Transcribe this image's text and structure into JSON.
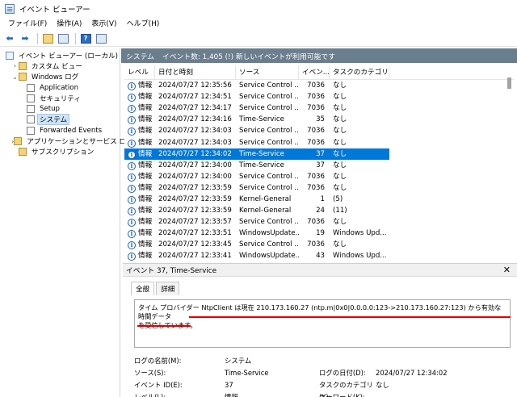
{
  "window": {
    "title": "イベント ビューアー"
  },
  "menu": [
    "ファイル(F)",
    "操作(A)",
    "表示(V)",
    "ヘルプ(H)"
  ],
  "toolbar": {
    "back": "⬅",
    "forward": "➡"
  },
  "tree": {
    "items": [
      {
        "label": "イベント ビューアー (ローカル)",
        "indent": 0,
        "exp": "",
        "icon": "app"
      },
      {
        "label": "カスタム ビュー",
        "indent": 1,
        "exp": "›",
        "icon": "folder"
      },
      {
        "label": "Windows ログ",
        "indent": 1,
        "exp": "⌄",
        "icon": "folder"
      },
      {
        "label": "Application",
        "indent": 2,
        "exp": "",
        "icon": "log"
      },
      {
        "label": "セキュリティ",
        "indent": 2,
        "exp": "",
        "icon": "log"
      },
      {
        "label": "Setup",
        "indent": 2,
        "exp": "",
        "icon": "log"
      },
      {
        "label": "システム",
        "indent": 2,
        "exp": "",
        "icon": "log",
        "selected": true
      },
      {
        "label": "Forwarded Events",
        "indent": 2,
        "exp": "",
        "icon": "log"
      },
      {
        "label": "アプリケーションとサービス ログ",
        "indent": 1,
        "exp": "›",
        "icon": "folder"
      },
      {
        "label": "サブスクリプション",
        "indent": 1,
        "exp": "",
        "icon": "folder"
      }
    ]
  },
  "events_header": {
    "name": "システム",
    "info": "イベント数: 1,405 (!) 新しいイベントが利用可能です"
  },
  "grid": {
    "columns": [
      "レベル",
      "日付と時刻",
      "ソース",
      "イベン...",
      "タスクのカテゴリ"
    ],
    "rows": [
      [
        "情報",
        "2024/07/27 12:35:56",
        "Service Control ...",
        "7036",
        "なし"
      ],
      [
        "情報",
        "2024/07/27 12:34:51",
        "Service Control ...",
        "7036",
        "なし"
      ],
      [
        "情報",
        "2024/07/27 12:34:17",
        "Service Control ...",
        "7036",
        "なし"
      ],
      [
        "情報",
        "2024/07/27 12:34:16",
        "Time-Service",
        "35",
        "なし"
      ],
      [
        "情報",
        "2024/07/27 12:34:03",
        "Service Control ...",
        "7036",
        "なし"
      ],
      [
        "情報",
        "2024/07/27 12:34:03",
        "Service Control ...",
        "7036",
        "なし"
      ],
      [
        "情報",
        "2024/07/27 12:34:02",
        "Time-Service",
        "37",
        "なし"
      ],
      [
        "情報",
        "2024/07/27 12:34:00",
        "Time-Service",
        "37",
        "なし"
      ],
      [
        "情報",
        "2024/07/27 12:34:00",
        "Service Control ...",
        "7036",
        "なし"
      ],
      [
        "情報",
        "2024/07/27 12:33:59",
        "Service Control ...",
        "7036",
        "なし"
      ],
      [
        "情報",
        "2024/07/27 12:33:59",
        "Kernel-General",
        "1",
        "(5)"
      ],
      [
        "情報",
        "2024/07/27 12:33:59",
        "Kernel-General",
        "24",
        "(11)"
      ],
      [
        "情報",
        "2024/07/27 12:33:57",
        "Service Control ...",
        "7036",
        "なし"
      ],
      [
        "情報",
        "2024/07/27 12:33:51",
        "WindowsUpdate...",
        "19",
        "Windows Upd..."
      ],
      [
        "情報",
        "2024/07/27 12:33:45",
        "Service Control ...",
        "7036",
        "なし"
      ],
      [
        "情報",
        "2024/07/27 12:33:41",
        "WindowsUpdate...",
        "43",
        "Windows Upd..."
      ]
    ],
    "selected_row": 6
  },
  "detail": {
    "title": "イベント 37, Time-Service",
    "close": "✕",
    "tabs": [
      "全般",
      "詳細"
    ],
    "description_line1": "タイム プロバイダー NtpClient は現在 210.173.160.27 (ntp.m|0x0|0.0.0.0:123->210.173.160.27:123) から有効な時間データ",
    "description_line2": "を受信しています。",
    "props": [
      [
        "ログの名前(M):",
        "システム",
        "",
        ""
      ],
      [
        "ソース(S):",
        "Time-Service",
        "ログの日付(D):",
        "2024/07/27 12:34:02"
      ],
      [
        "イベント ID(E):",
        "37",
        "タスクのカテゴリ(Y):",
        "なし"
      ],
      [
        "レベル(L):",
        "情報",
        "キーワード(K):",
        ""
      ]
    ]
  },
  "colors": {
    "selection": "#0078d7",
    "header_bar": "#6b7e8e",
    "annotation": "#e00000"
  }
}
